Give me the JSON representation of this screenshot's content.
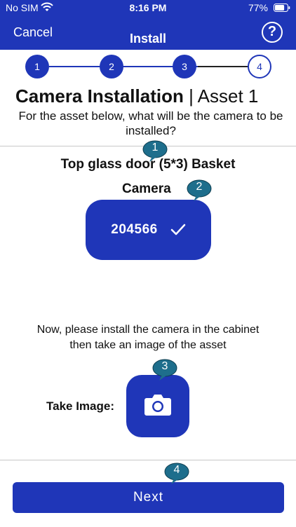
{
  "status_bar": {
    "carrier": "No SIM",
    "time": "8:16 PM",
    "battery": "77%",
    "battery_level": 0.77
  },
  "nav": {
    "cancel_label": "Cancel",
    "title": "Install",
    "help_symbol": "?"
  },
  "stepper": {
    "steps": [
      "1",
      "2",
      "3",
      "4"
    ],
    "current_step": 4,
    "completed_color": "#1f36b8"
  },
  "page": {
    "title_bold": "Camera Installation",
    "title_separator": " | ",
    "title_rest": "Asset 1",
    "subtitle": "For the asset below, what will be the  camera to be installed?"
  },
  "asset": {
    "name": "Top glass door (5*3) Basket",
    "camera_label": "Camera",
    "camera_value": "204566"
  },
  "instruction": "Now, please install the camera in the cabinet then take an image of the asset",
  "take_image_label": "Take Image:",
  "next_label": "Next",
  "markers": [
    "1",
    "2",
    "3",
    "4"
  ],
  "colors": {
    "primary": "#1f36b8",
    "marker": "#1e6e8c",
    "background": "#ffffff"
  },
  "icons": {
    "wifi": "wifi-icon",
    "battery": "battery-icon",
    "help": "help-icon",
    "check": "check-icon",
    "camera": "camera-icon"
  }
}
